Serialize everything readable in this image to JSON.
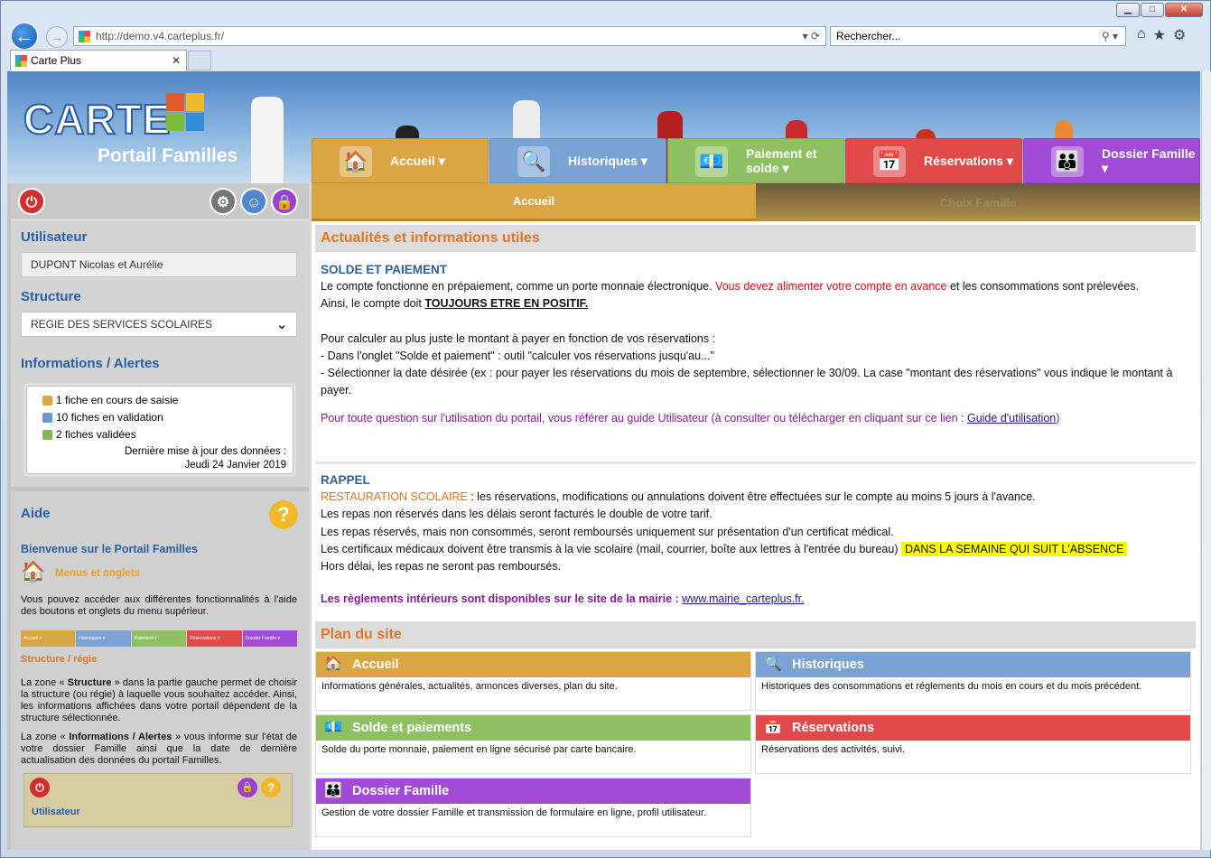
{
  "browser": {
    "url": "http://demo.v4.carteplus.fr/",
    "search_placeholder": "Rechercher...",
    "tab_title": "Carte Plus"
  },
  "header": {
    "logo": "CARTE",
    "subtitle": "Portail Familles"
  },
  "nav": [
    {
      "label": "Accueil ▾",
      "color": "#dba544",
      "icon": "house-icon"
    },
    {
      "label": "Historiques ▾",
      "color": "#7aa3d4",
      "icon": "magnifier-icon"
    },
    {
      "label": "Paiement et solde ▾",
      "color": "#8fc163",
      "icon": "money-icon"
    },
    {
      "label": "Réservations ▾",
      "color": "#e04a4a",
      "icon": "calendar-icon"
    },
    {
      "label": "Dossier Famille ▾",
      "color": "#a24bd6",
      "icon": "family-icon"
    }
  ],
  "subnav": {
    "accueil": "Accueil",
    "choix": "Choix Famille"
  },
  "left": {
    "user_title": "Utilisateur",
    "user_name": "DUPONT Nicolas et Aurélie",
    "structure_title": "Structure",
    "structure_value": "REGIE DES SERVICES SCOLAIRES",
    "info_title": "Informations / Alertes",
    "alerts": [
      {
        "text": "1 fiche en cours de saisie",
        "color": "#e0a43a"
      },
      {
        "text": "10 fiches en validation",
        "color": "#6f97cf"
      },
      {
        "text": "2 fiches validées",
        "color": "#7cbb55"
      }
    ],
    "update_label": "Dernière mise à jour des données :",
    "update_date": "Jeudi 24 Janvier 2019",
    "aide_title": "Aide",
    "welcome": "Bienvenue sur le Portail Familles",
    "menus_title": "Menus et onglets",
    "menus_text": "Vous pouvez accéder aux différentes fonctionnalités à l'aide des boutons et onglets du menu supérieur.",
    "structure_help_title": "Structure / régie",
    "structure_help_1a": "La zone « ",
    "structure_help_1b": "Structure",
    "structure_help_1c": " » dans la partie gauche permet de choisir la structure (ou régie) à laquelle vous souhaitez accéder. Ainsi, les informations affichées dans votre portail dépendent de la structure sélectionnée.",
    "structure_help_2a": "La zone « ",
    "structure_help_2b": "Informations / Alertes",
    "structure_help_2c": " » vous informe sur l'état de votre dossier Famille ainsi que la date de dernière actualisation des données du portail Familles.",
    "mini_user": "Utilisateur",
    "mini_tabs": [
      "Accueil ▾",
      "Historiques ▾",
      "Paiement ▾",
      "Réservations ▾",
      "Dossier Famille ▾"
    ]
  },
  "main": {
    "news_title": "Actualités et informations utiles",
    "solde_title": "SOLDE ET PAIEMENT",
    "p1a": "Le compte fonctionne en prépaiement, comme un porte monnaie électronique. ",
    "p1b": "Vous devez alimenter votre compte en avance",
    "p1c": " et les consommations sont prélevées.",
    "p2a": "Ainsi, le compte doit ",
    "p2b": "TOUJOURS ETRE EN POSITIF.",
    "p3": "Pour calculer au plus juste le montant à payer en fonction de vos réservations :",
    "p4": "- Dans l'onglet \"Solde et paiement\" : outil \"calculer vos réservations jusqu'au...\"",
    "p5": "- Sélectionner la date désirée (ex : pour payer les réservations du mois de septembre, sélectionner le 30/09. La case \"montant des réservations\" vous indique le montant à payer.",
    "p6a": "Pour toute question sur l'utilisation du portail, vous référer au guide Utilisateur (à consulter ou télécharger en cliquant sur ce lien : ",
    "p6b": "Guide d'utilisation",
    "p6c": ")",
    "rappel_title": "RAPPEL",
    "r1a": "RESTAURATION SCOLAIRE",
    "r1b": " : les réservations, modifications ou annulations doivent être effectuées sur le compte au moins 5 jours à l'avance.",
    "r2": "Les repas non réservés dans les délais seront facturés le double de votre tarif.",
    "r3": "Les repas réservés, mais non consommés, seront remboursés uniquement sur présentation d'un certificat médical.",
    "r4a": "Les certificaux médicaux doivent être transmis à la vie scolaire (mail, courrier, boîte aux lettres à l'entrée du bureau) ",
    "r4b": "DANS LA SEMAINE QUI SUIT L'ABSENCE",
    "r5": "Hors délai, les repas ne seront pas remboursés.",
    "r6a": "Les règlements intérieurs sont disponibles sur le site de la mairie : ",
    "r6b": "www.mairie_carteplus.fr.",
    "plan_title": "Plan du site",
    "cards": [
      {
        "title": "Accueil",
        "text": "Informations générales, actualités, annonces diverses, plan du site.",
        "color": "#dba544",
        "icon": "house-icon"
      },
      {
        "title": "Historiques",
        "text": "Historiques des consommations et réglements du mois en cours et du mois précédent.",
        "color": "#7aa3d4",
        "icon": "magnifier-icon"
      },
      {
        "title": "Solde et paiements",
        "text": "Solde du porte monnaie, paiement en ligne sécurisé par carte bancaire.",
        "color": "#8fc163",
        "icon": "money-icon"
      },
      {
        "title": "Réservations",
        "text": "Réservations des activités, suivi.",
        "color": "#e04a4a",
        "icon": "calendar-icon"
      },
      {
        "title": "Dossier Famille",
        "text": "Gestion de votre dossier Famille et transmission de formulaire en ligne, profil utilisateur.",
        "color": "#a24bd6",
        "icon": "family-icon"
      }
    ]
  }
}
